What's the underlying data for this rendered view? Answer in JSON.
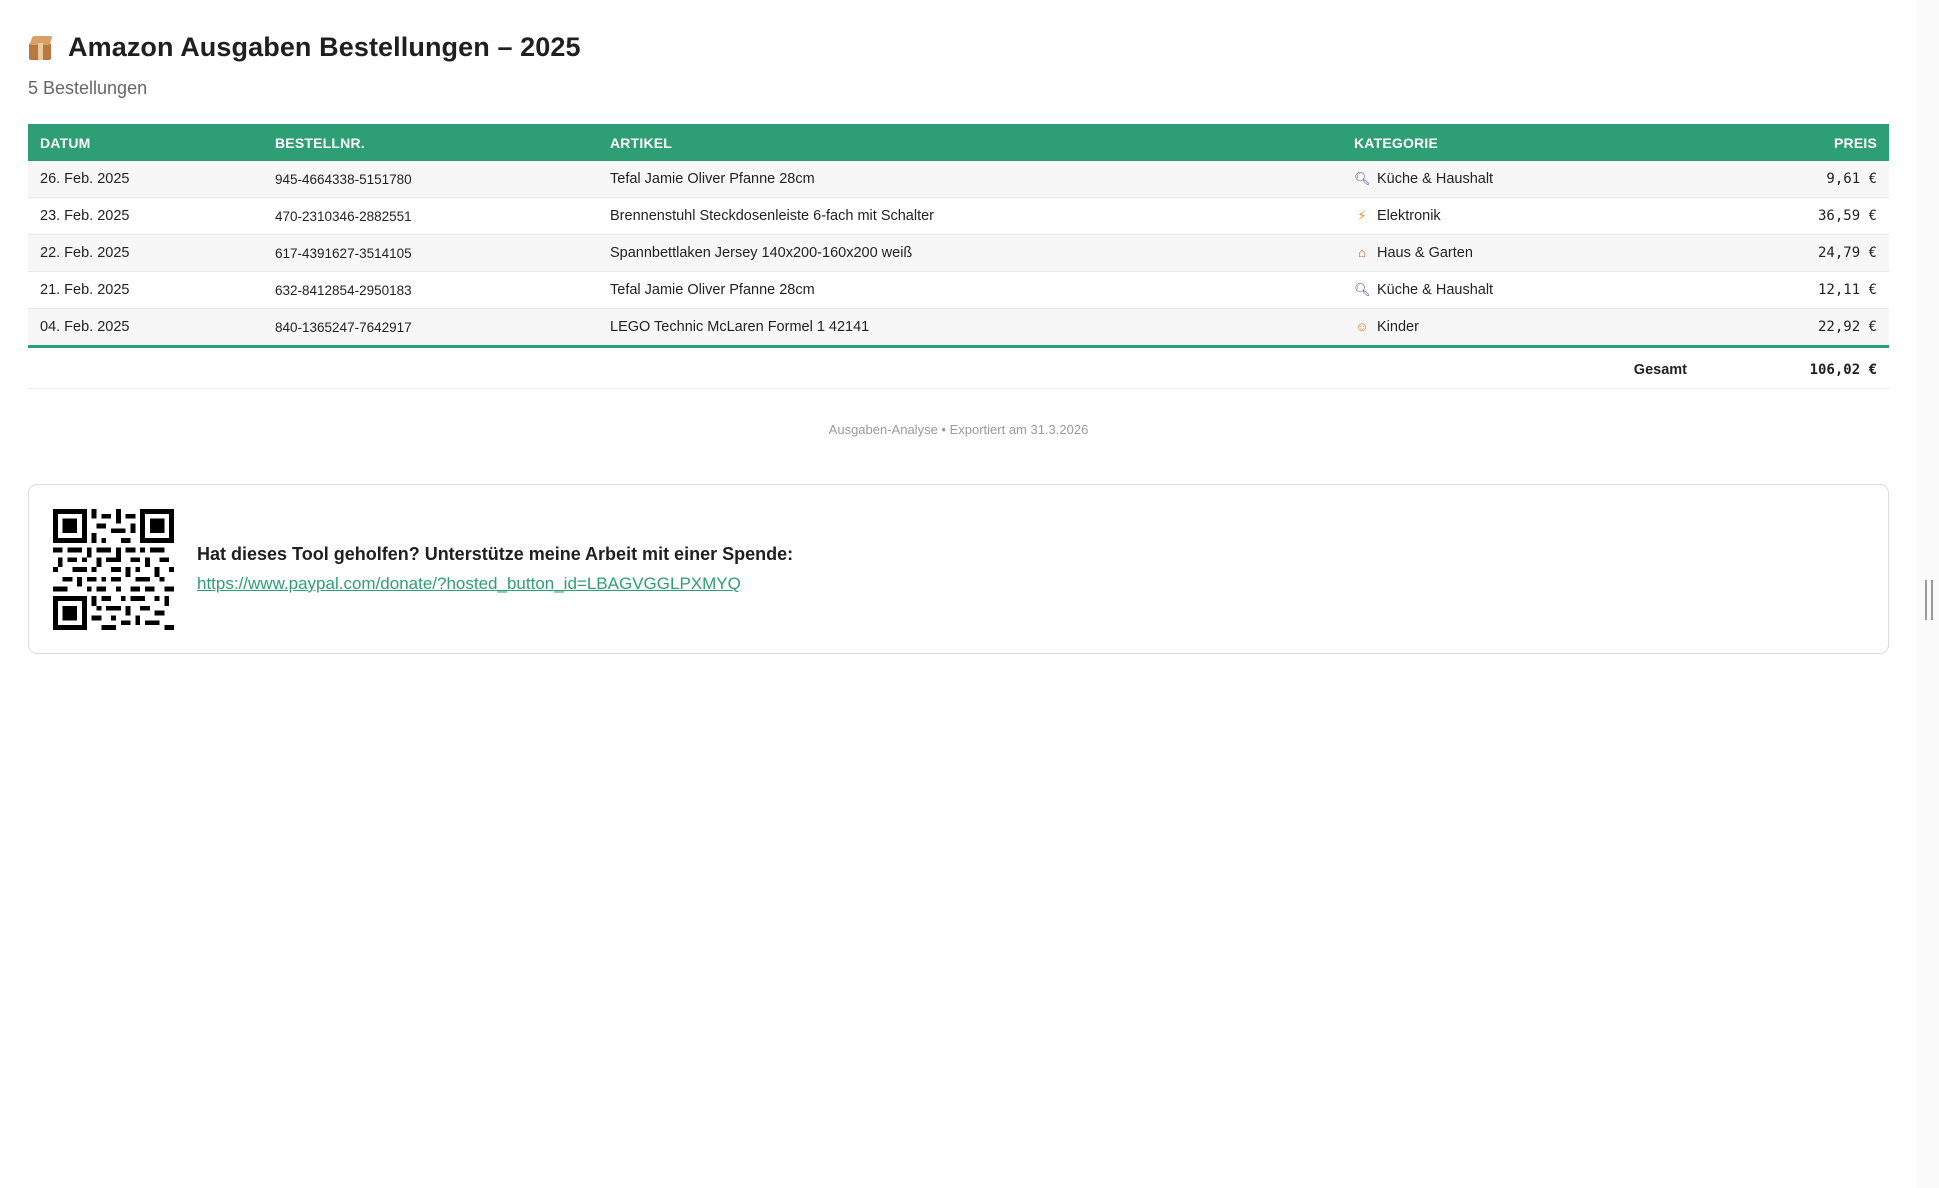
{
  "header": {
    "title": "Amazon Ausgaben Bestellungen – 2025",
    "subtitle": "5 Bestellungen",
    "icon": "package-icon"
  },
  "table": {
    "columns": [
      "Datum",
      "Bestellnr.",
      "Artikel",
      "Kategorie",
      "Preis"
    ],
    "rows": [
      {
        "date": "26. Feb. 2025",
        "order": "945-4664338-5151780",
        "item": "Tefal Jamie Oliver Pfanne 28cm",
        "category": "Küche & Haushalt",
        "category_icon": "search-icon",
        "price": "9,61 €"
      },
      {
        "date": "23. Feb. 2025",
        "order": "470-2310346-2882551",
        "item": "Brennenstuhl Steckdosenleiste 6-fach mit Schalter",
        "category": "Elektronik",
        "category_icon": "lightning-icon",
        "price": "36,59 €"
      },
      {
        "date": "22. Feb. 2025",
        "order": "617-4391627-3514105",
        "item": "Spannbettlaken Jersey 140x200-160x200 weiß",
        "category": "Haus & Garten",
        "category_icon": "house-icon",
        "price": "24,79 €"
      },
      {
        "date": "21. Feb. 2025",
        "order": "632-8412854-2950183",
        "item": "Tefal Jamie Oliver Pfanne 28cm",
        "category": "Küche & Haushalt",
        "category_icon": "search-icon",
        "price": "12,11 €"
      },
      {
        "date": "04. Feb. 2025",
        "order": "840-1365247-7642917",
        "item": "LEGO Technic McLaren Formel 1 42141",
        "category": "Kinder",
        "category_icon": "child-icon",
        "price": "22,92 €"
      }
    ],
    "total_label": "Gesamt",
    "total_value": "106,02 €"
  },
  "footer": {
    "note": "Ausgaben-Analyse • Exportiert am 31.3.2026"
  },
  "donate": {
    "text": "Hat dieses Tool geholfen? Unterstütze meine Arbeit mit einer Spende:",
    "link": "https://www.paypal.com/donate/?hosted_button_id=LBAGVGGLPXMYQ"
  },
  "colors": {
    "accent": "#2e9e74",
    "text": "#222222",
    "muted": "#9a9a9a"
  }
}
